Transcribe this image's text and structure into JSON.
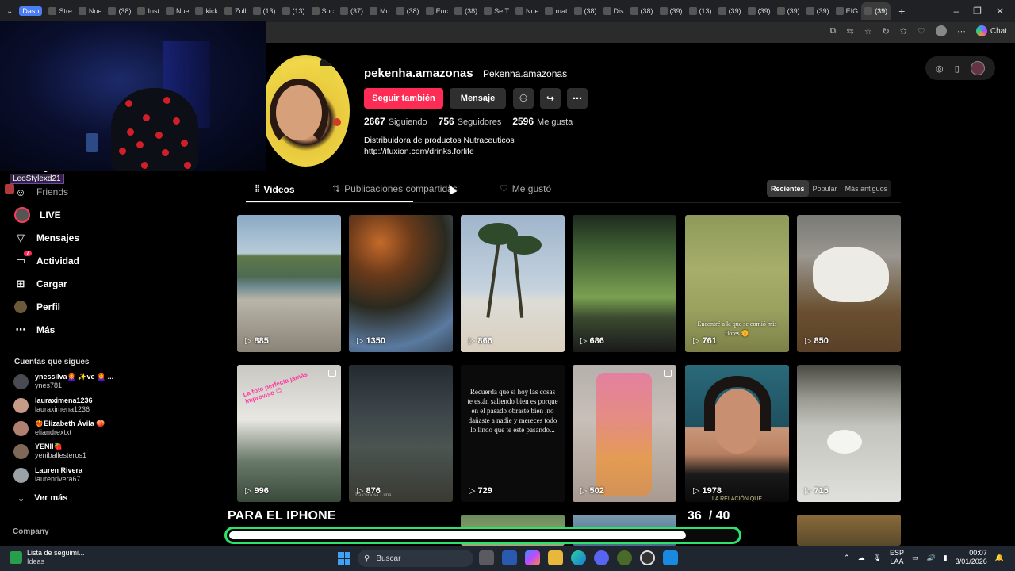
{
  "browser": {
    "tabs": [
      "Dash",
      "Stre",
      "Nue",
      "(38)",
      "Inst",
      "Nue",
      "kick",
      "Zull",
      "(13)",
      "(13)",
      "Soc",
      "(37)",
      "Mo",
      "(38)",
      "Enc",
      "(38)",
      "Se T",
      "Nue",
      "mat",
      "(38)",
      "Dis",
      "(38)",
      "(39)",
      "(13)",
      "(39)",
      "(39)",
      "(39)",
      "(39)",
      "EIG",
      "(39)"
    ],
    "chat_label": "Chat"
  },
  "stream": {
    "streamer_name": "LeoStylexd21"
  },
  "sidebar": {
    "hidden_item": "Siguiendo",
    "nav": [
      {
        "label": "Friends",
        "icon": "friends-icon"
      },
      {
        "label": "LIVE",
        "icon": "live-icon"
      },
      {
        "label": "Mensajes",
        "icon": "messages-icon"
      },
      {
        "label": "Actividad",
        "icon": "activity-icon",
        "badge": "7"
      },
      {
        "label": "Cargar",
        "icon": "upload-icon"
      },
      {
        "label": "Perfil",
        "icon": "profile-icon"
      },
      {
        "label": "Más",
        "icon": "more-icon"
      }
    ],
    "following_title": "Cuentas que sigues",
    "accounts": [
      {
        "name": "ynessilva👩‍🦰 ✨ve 👩‍🦰 ...",
        "username": "ynes781"
      },
      {
        "name": "lauraximena1236",
        "username": "lauraximena1236"
      },
      {
        "name": "❤️‍🔥Elizabeth Ávila 🍑",
        "username": "eliandrextxt"
      },
      {
        "name": "YENII🍓",
        "username": "yeniballesteros1"
      },
      {
        "name": "Lauren Rivera",
        "username": "laurenrivera67"
      }
    ],
    "see_more": "Ver más",
    "company": "Company"
  },
  "profile": {
    "username": "pekenha.amazonas",
    "nickname": "Pekenha.amazonas",
    "follow_back": "Seguir también",
    "message": "Mensaje",
    "stats": {
      "following": "2667",
      "following_label": "Siguiendo",
      "followers": "756",
      "followers_label": "Seguidores",
      "likes": "2596",
      "likes_label": "Me gusta"
    },
    "bio_line1": "Distribuidora de productos Nutraceuticos",
    "bio_line2": "http://ifuxion.com/drinks.forlife"
  },
  "tabs": {
    "videos": "Videos",
    "reposts": "Publicaciones compartidas",
    "liked": "Me gustó",
    "sort": [
      "Recientes",
      "Popular",
      "Más antiguos"
    ],
    "sort_active": "Recientes"
  },
  "videos": [
    {
      "views": "885"
    },
    {
      "views": "1350"
    },
    {
      "views": "866"
    },
    {
      "views": "686"
    },
    {
      "views": "761",
      "caption": "Encontré a la que se comió mis flores 🌼"
    },
    {
      "views": "850"
    },
    {
      "views": "996",
      "caption": "La foto perfecta jamás improviso 😊"
    },
    {
      "views": "876",
      "caption": "La curiosa Luna ."
    },
    {
      "views": "729",
      "caption": "Recuerda que si hoy las cosas te están saliendo bien es porque en el pasado obraste bien ,no dañaste a nadie y mereces todo lo lindo que te este pasando..."
    },
    {
      "views": "502"
    },
    {
      "views": "1978",
      "caption": "LA RELACIÓN QUE"
    },
    {
      "views": "715"
    }
  ],
  "overlay": {
    "title": "PARA EL IPHONE",
    "count_current": "36",
    "count_total": "/ 40",
    "progress": 0.9
  },
  "taskbar": {
    "weather_line1": "Lista de seguimi...",
    "weather_line2": "Ideas",
    "search_placeholder": "Buscar",
    "lang1": "ESP",
    "lang2": "LAA",
    "time": "00:07",
    "date": "3/01/2026"
  }
}
